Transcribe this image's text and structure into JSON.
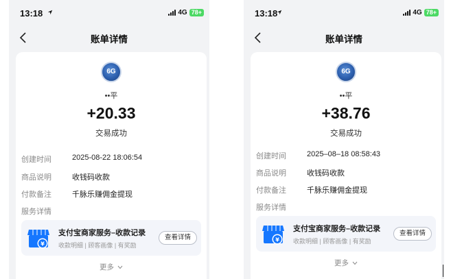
{
  "left": {
    "time": "13:18",
    "network": "4G",
    "battery": "78+",
    "title": "账单详情",
    "avatar_text": "6G",
    "name": "••平",
    "amount": "+20.33",
    "status": "交易成功",
    "details": [
      {
        "label": "创建时间",
        "value": "2025-08-22 18:06:54"
      },
      {
        "label": "商品说明",
        "value": "收钱码收款"
      },
      {
        "label": "付款备注",
        "value": "千脉乐赚佣金提现"
      },
      {
        "label": "服务详情",
        "value": ""
      }
    ],
    "service": {
      "title": "支付宝商家服务–收款记录",
      "subtitle": "收款明细 | 顾客画像 | 有奖励",
      "button": "查看详情"
    },
    "more": "更多"
  },
  "right": {
    "time": "13:18",
    "network": "4G",
    "battery": "78+",
    "title": "账单详情",
    "avatar_text": "6G",
    "name": "••平",
    "amount": "+38.76",
    "status": "交易成功",
    "details": [
      {
        "label": "创建时间",
        "value": "2025–08–18 08:58:43"
      },
      {
        "label": "商品说明",
        "value": "收钱码收款"
      },
      {
        "label": "付款备注",
        "value": "千脉乐赚佣金提现"
      },
      {
        "label": "服务详情",
        "value": ""
      }
    ],
    "service": {
      "title": "支付宝商家服务–收款记录",
      "subtitle": "收款明细 | 顾客画像 | 有奖励",
      "button": "查看详情"
    },
    "more": "更多"
  },
  "colors": {
    "accent_blue": "#1677ff",
    "battery_green": "#4cd964",
    "background": "#f2f3f5"
  }
}
